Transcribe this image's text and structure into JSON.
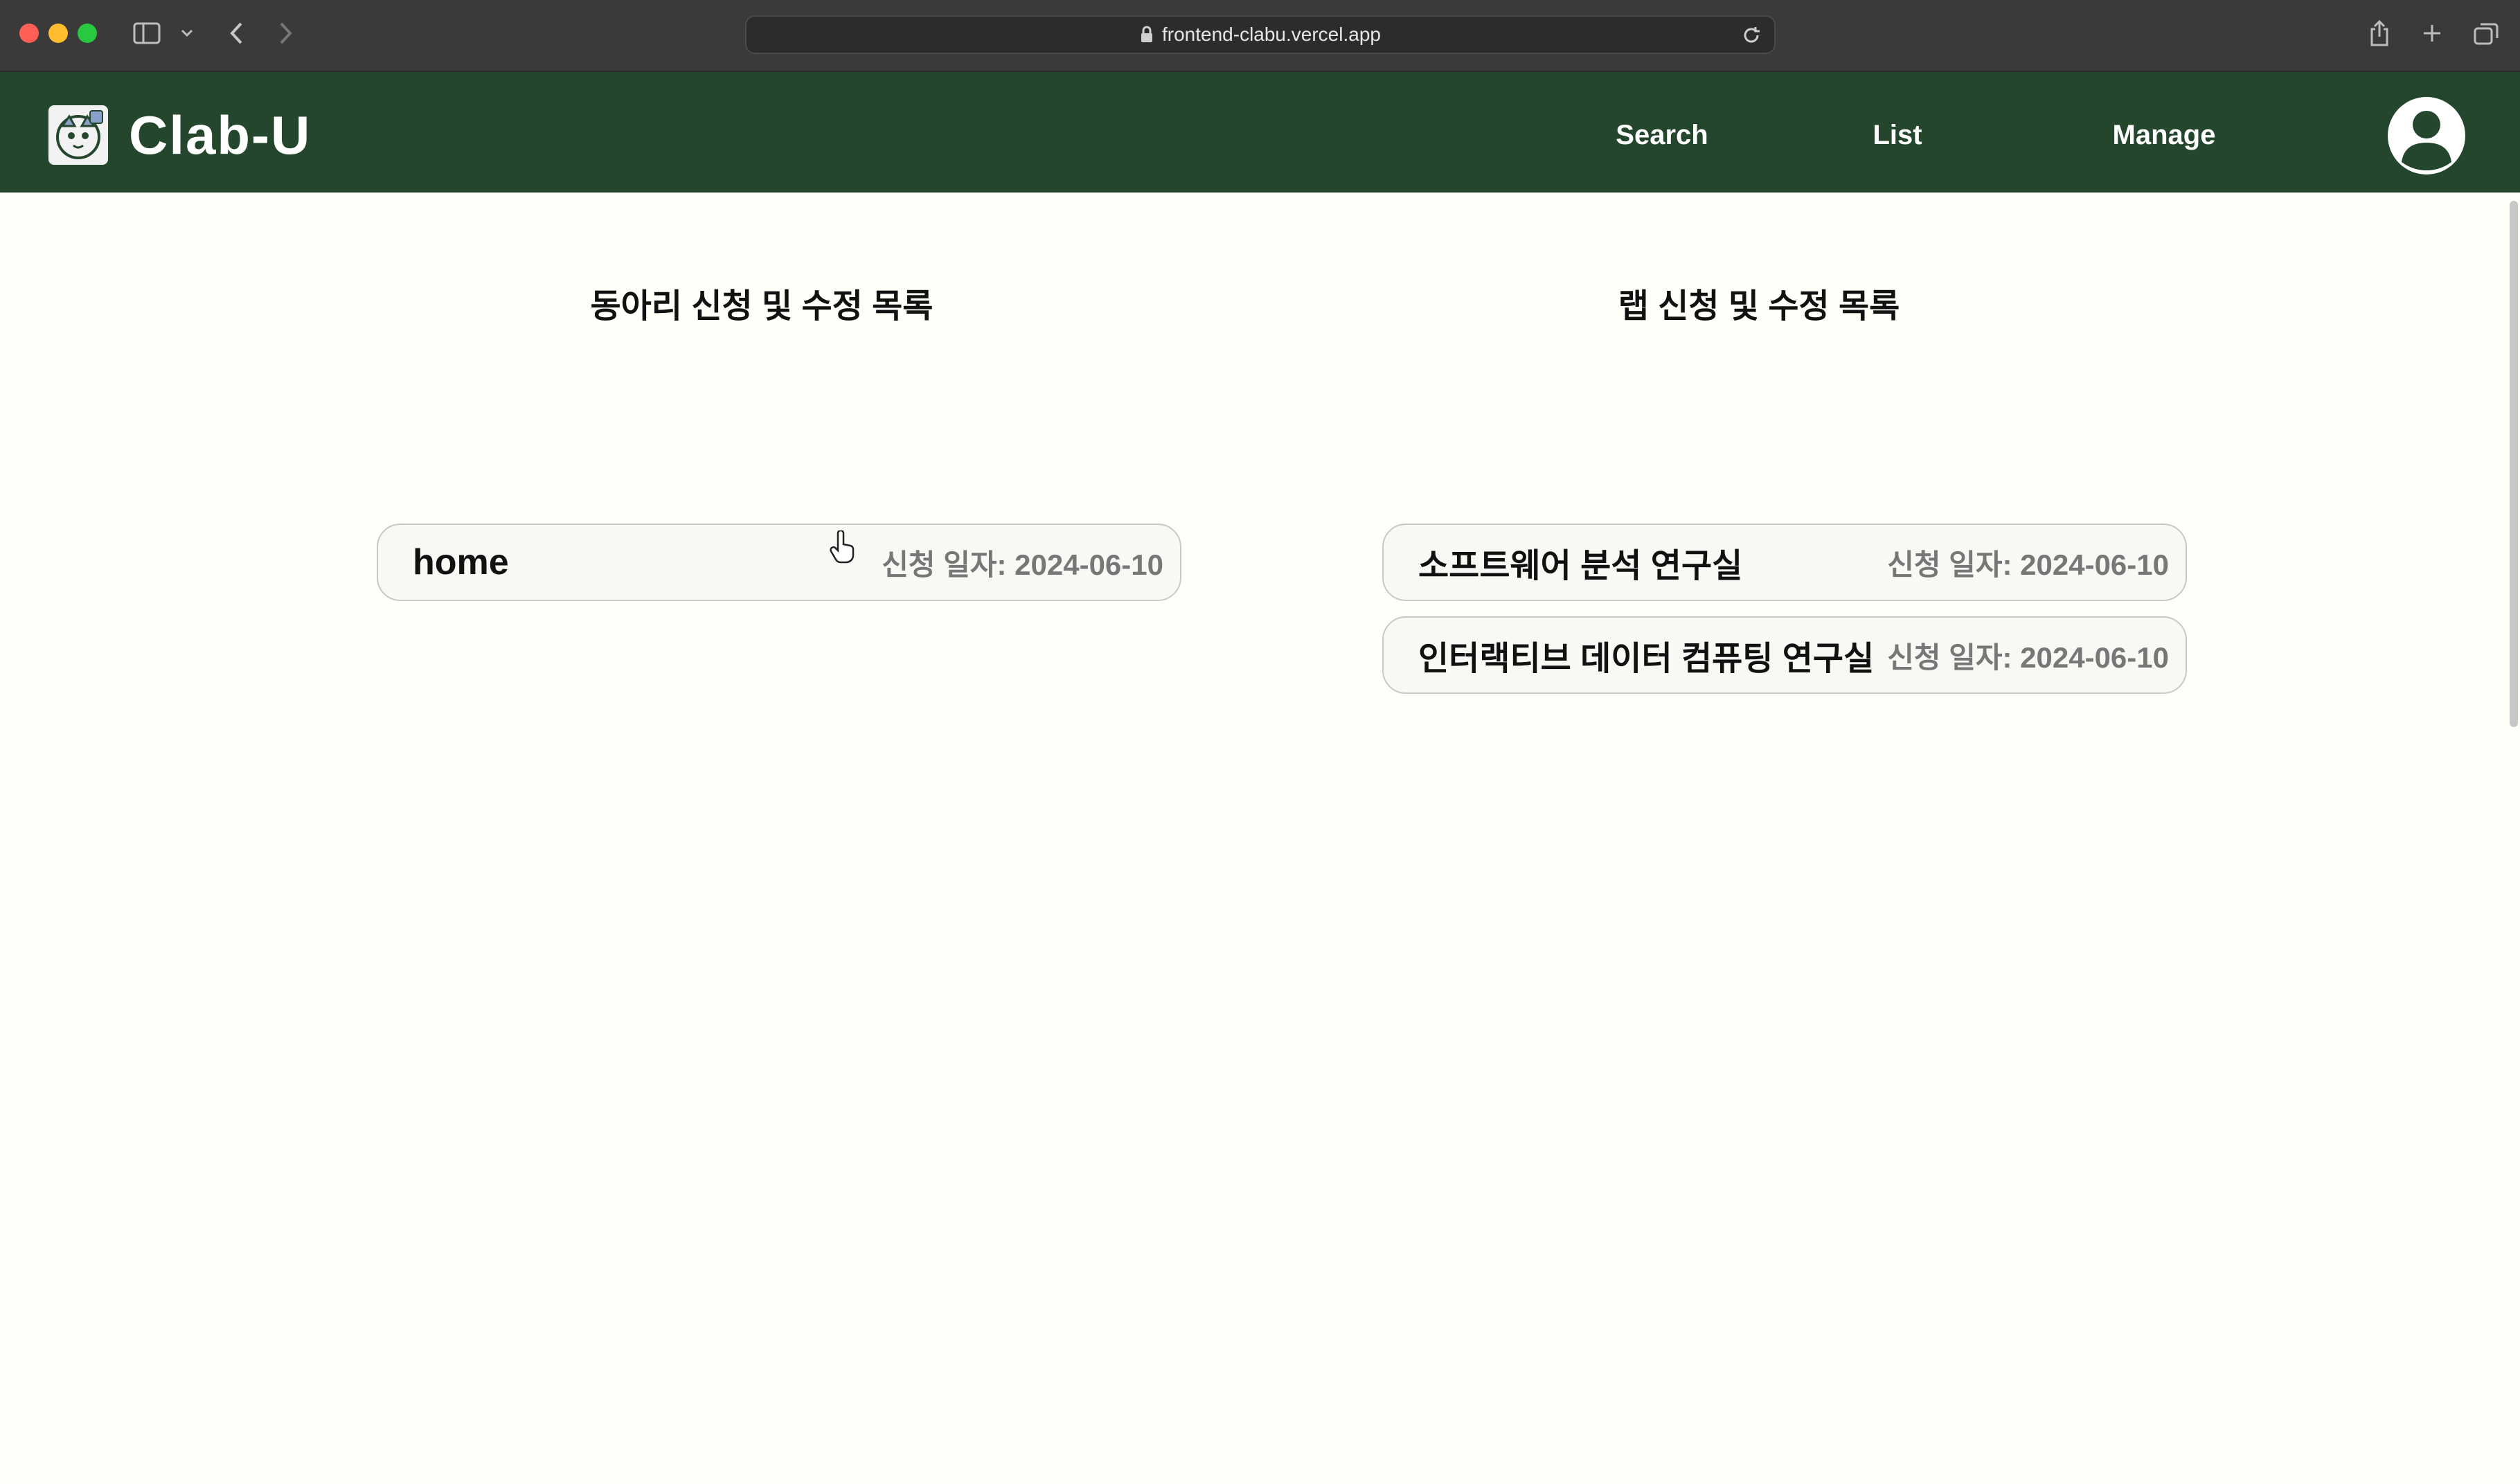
{
  "browser": {
    "url": "frontend-clabu.vercel.app",
    "icons": {
      "sidebar": "sidebar-icon",
      "chevron": "chevron-down-icon",
      "back": "back-arrow-icon",
      "forward": "forward-arrow-icon",
      "lock": "lock-icon",
      "reload": "reload-icon",
      "share": "share-icon",
      "new_tab": "plus-icon",
      "tab_overview": "tabs-icon"
    }
  },
  "app": {
    "brand": "Clab-U",
    "nav": {
      "search": "Search",
      "list": "List",
      "manage": "Manage"
    },
    "colors": {
      "nav_background": "#24462d",
      "page_background": "#fffffa",
      "card_border": "#c8c8c8",
      "date_text": "#777777"
    }
  },
  "main": {
    "club_section": {
      "title": "동아리 신청 및 수정 목록",
      "items": [
        {
          "name": "home",
          "date": "신청 일자: 2024-06-10"
        }
      ]
    },
    "lab_section": {
      "title": "랩 신청 및 수정 목록",
      "items": [
        {
          "name": "소프트웨어 분석 연구실",
          "date": "신청 일자: 2024-06-10"
        },
        {
          "name": "인터랙티브 데이터 컴퓨팅 연구실",
          "date": "신청 일자: 2024-06-10"
        }
      ]
    }
  }
}
